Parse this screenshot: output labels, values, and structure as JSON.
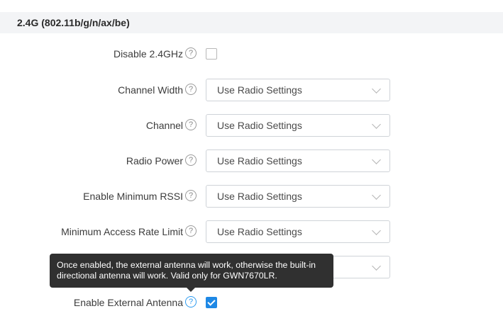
{
  "section": {
    "title": "2.4G (802.11b/g/n/ax/be)"
  },
  "fields": [
    {
      "label": "Disable 2.4GHz",
      "type": "checkbox",
      "checked": false
    },
    {
      "label": "Channel Width",
      "type": "select",
      "value": "Use Radio Settings"
    },
    {
      "label": "Channel",
      "type": "select",
      "value": "Use Radio Settings"
    },
    {
      "label": "Radio Power",
      "type": "select",
      "value": "Use Radio Settings"
    },
    {
      "label": "Enable Minimum RSSI",
      "type": "select",
      "value": "Use Radio Settings"
    },
    {
      "label": "Minimum Access Rate Limit",
      "type": "select",
      "value": "Use Radio Settings"
    },
    {
      "label": "",
      "type": "select",
      "value": ""
    },
    {
      "label": "Enable External Antenna",
      "type": "checkbox",
      "checked": true
    }
  ],
  "help_icon_glyph": "?",
  "tooltip": {
    "text": "Once enabled, the external antenna will work, otherwise the built-in directional antenna will work. Valid only for GWN7670LR."
  },
  "colors": {
    "accent": "#1e88e5",
    "help_active": "#2d9bf0",
    "tooltip_bg": "#303030",
    "header_bg": "#f3f4f6"
  }
}
